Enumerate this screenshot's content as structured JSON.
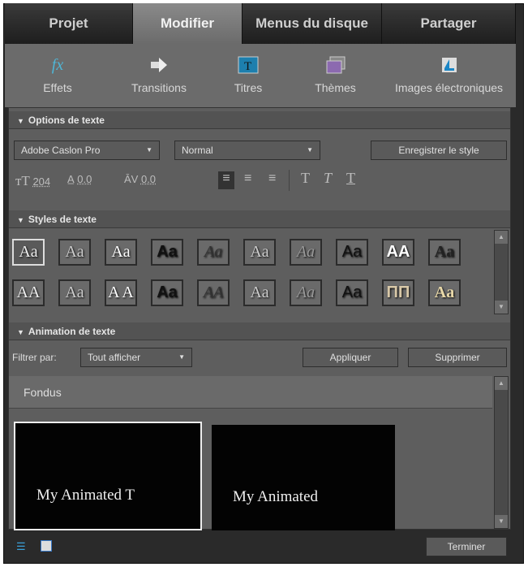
{
  "tabs": [
    {
      "label": "Projet"
    },
    {
      "label": "Modifier"
    },
    {
      "label": "Menus du disque"
    },
    {
      "label": "Partager"
    }
  ],
  "toolbar": [
    {
      "label": "Effets",
      "icon": "fx-icon"
    },
    {
      "label": "Transitions",
      "icon": "arrow-icon"
    },
    {
      "label": "Titres",
      "icon": "titles-icon"
    },
    {
      "label": "Thèmes",
      "icon": "themes-icon"
    },
    {
      "label": "Images électroniques",
      "icon": "clipart-icon"
    }
  ],
  "options": {
    "header": "Options de texte",
    "font": "Adobe Caslon Pro",
    "style": "Normal",
    "save_style": "Enregistrer le style",
    "size": "204",
    "leading": "0.0",
    "kerning": "0.0"
  },
  "styles": {
    "header": "Styles de texte",
    "swatches": [
      "Aa",
      "Aa",
      "Aa",
      "Aa",
      "Aa",
      "Aa",
      "Aa",
      "Aa",
      "AA",
      "Aa",
      "AA",
      "Aa",
      "A A",
      "Aa",
      "AA",
      "Aa",
      "Aa",
      "Aa",
      "ΠΠ",
      "Aa"
    ]
  },
  "animation": {
    "header": "Animation de texte",
    "filter_label": "Filtrer par:",
    "filter_value": "Tout afficher",
    "apply": "Appliquer",
    "delete": "Supprimer",
    "category": "Fondus",
    "thumbs": [
      "My Animated T",
      "My Animated"
    ]
  },
  "footer": {
    "done": "Terminer"
  }
}
